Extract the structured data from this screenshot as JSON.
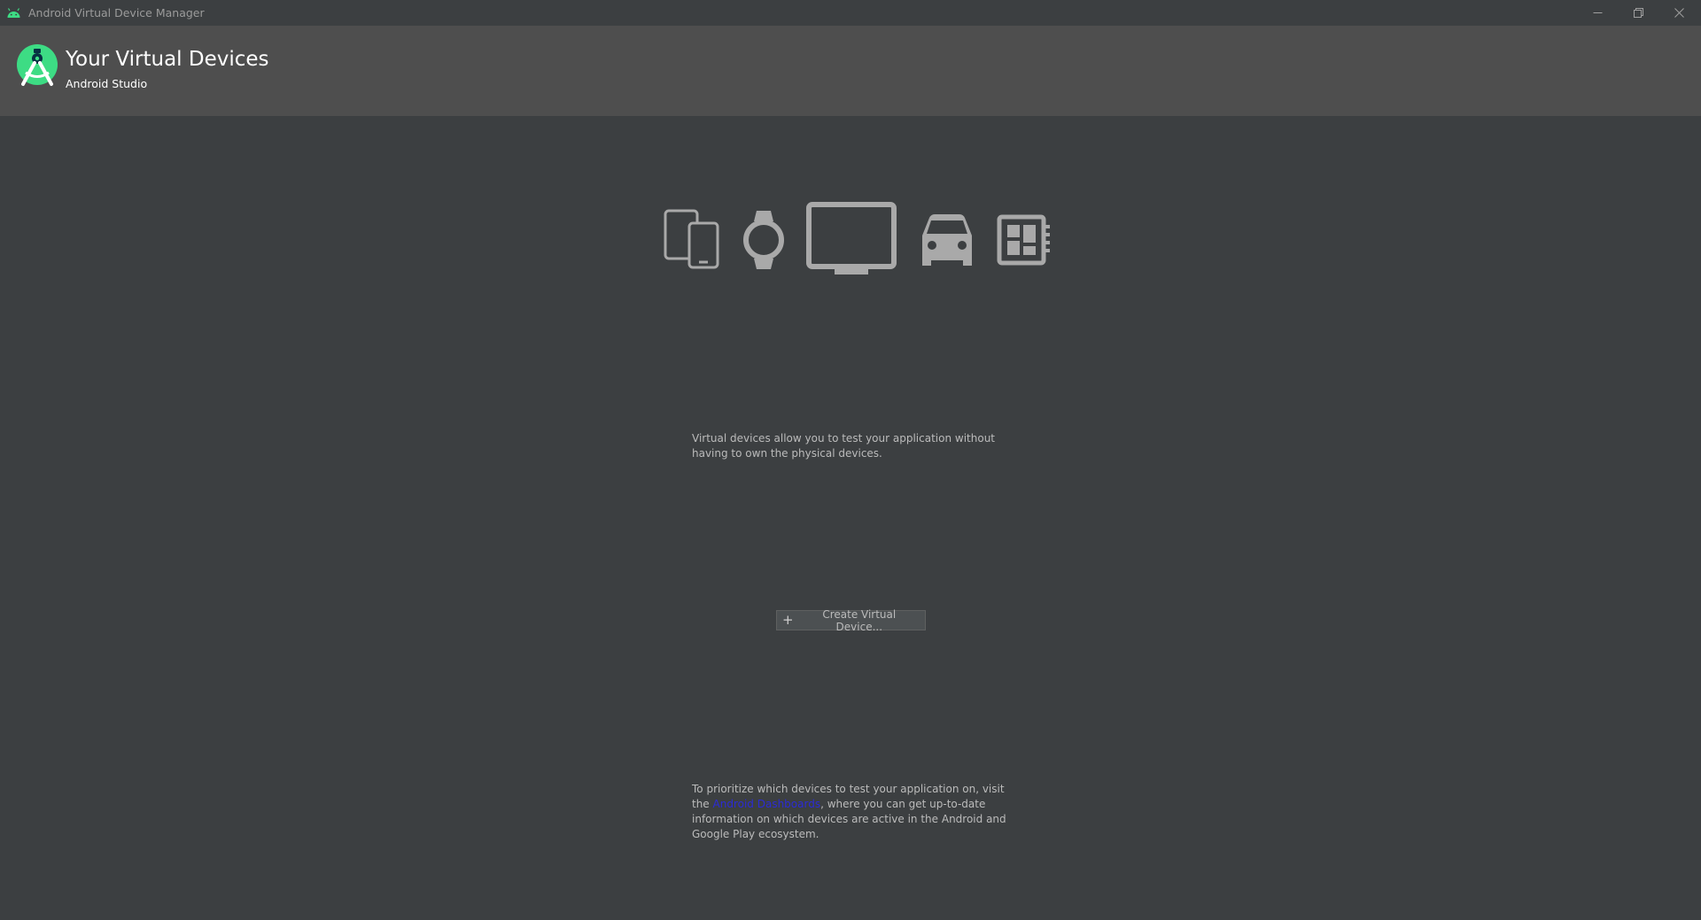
{
  "window": {
    "title": "Android Virtual Device Manager",
    "app_icon": "android-icon",
    "controls": [
      "minimize-icon",
      "restore-icon",
      "close-icon"
    ]
  },
  "header": {
    "title": "Your Virtual Devices",
    "subtitle": "Android Studio",
    "logo": "android-studio-logo"
  },
  "device_types": [
    "phone-tablet-icon",
    "watch-icon",
    "tv-icon",
    "car-icon",
    "things-icon"
  ],
  "main": {
    "description": "Virtual devices allow you to test your application without having to own the physical devices.",
    "create_button_label": "Create Virtual Device...",
    "footer_prefix": "To prioritize which devices to test your application on, visit the ",
    "footer_link": "Android Dashboards",
    "footer_suffix": ", where you can get up-to-date information on which devices are active in the Android and Google Play ecosystem."
  },
  "colors": {
    "background": "#3c3f41",
    "header_background": "#4e4e4e",
    "icon_gray": "#a9a9a9",
    "android_green": "#3ddc84",
    "link": "#2b2bd6"
  }
}
